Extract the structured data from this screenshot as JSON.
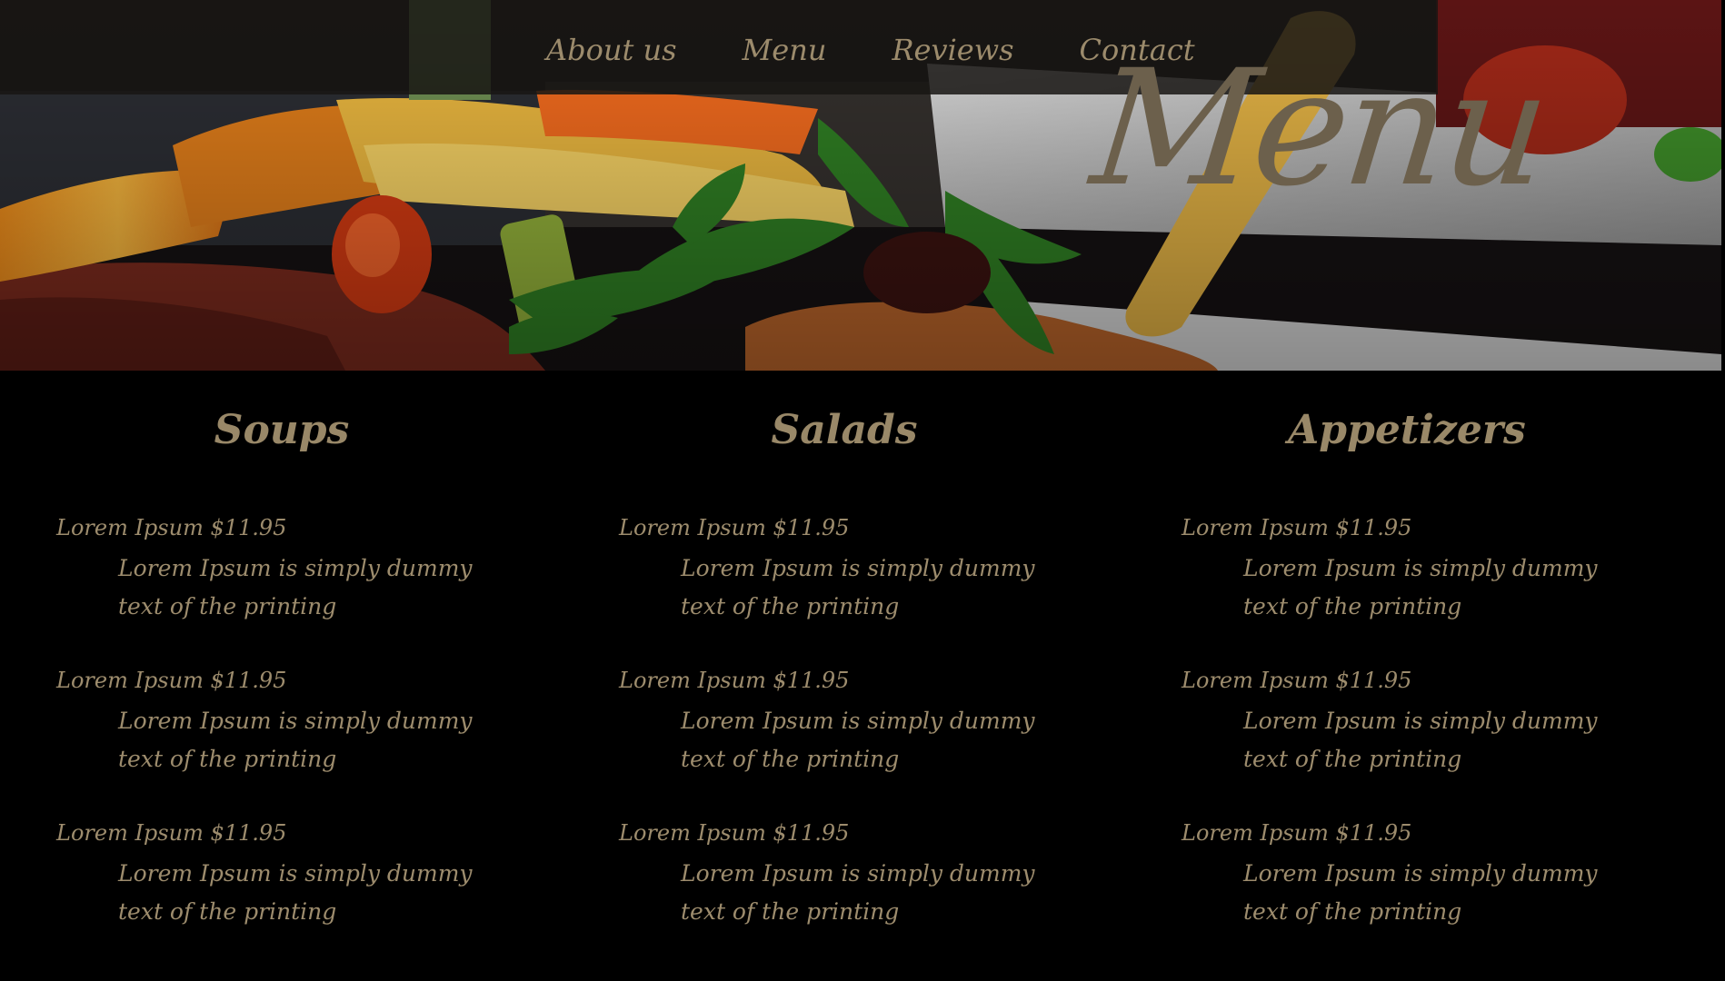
{
  "nav": {
    "items": [
      {
        "label": "About us"
      },
      {
        "label": "Menu"
      },
      {
        "label": "Reviews"
      },
      {
        "label": "Contact"
      }
    ]
  },
  "hero": {
    "title": "Menu"
  },
  "menu": {
    "columns": [
      {
        "heading": "Soups",
        "items": [
          {
            "title": "Lorem Ipsum $11.95",
            "description": "Lorem Ipsum is simply dummy text of the printing"
          },
          {
            "title": "Lorem Ipsum $11.95",
            "description": "Lorem Ipsum is simply dummy text of the printing"
          },
          {
            "title": "Lorem Ipsum $11.95",
            "description": "Lorem Ipsum is simply dummy text of the printing"
          }
        ]
      },
      {
        "heading": "Salads",
        "items": [
          {
            "title": "Lorem Ipsum $11.95",
            "description": "Lorem Ipsum is simply dummy text of the printing"
          },
          {
            "title": "Lorem Ipsum $11.95",
            "description": "Lorem Ipsum is simply dummy text of the printing"
          },
          {
            "title": "Lorem Ipsum $11.95",
            "description": "Lorem Ipsum is simply dummy text of the printing"
          }
        ]
      },
      {
        "heading": "Appetizers",
        "items": [
          {
            "title": "Lorem Ipsum $11.95",
            "description": "Lorem Ipsum is simply dummy text of the printing"
          },
          {
            "title": "Lorem Ipsum $11.95",
            "description": "Lorem Ipsum is simply dummy text of the printing"
          },
          {
            "title": "Lorem Ipsum $11.95",
            "description": "Lorem Ipsum is simply dummy text of the printing"
          }
        ]
      }
    ]
  },
  "colors": {
    "background": "#000000",
    "text": "#9d8c6d",
    "title_overlay": "#6c604c",
    "navbar": "#181614"
  },
  "icons": {
    "hero_image": "food-plate-image"
  }
}
